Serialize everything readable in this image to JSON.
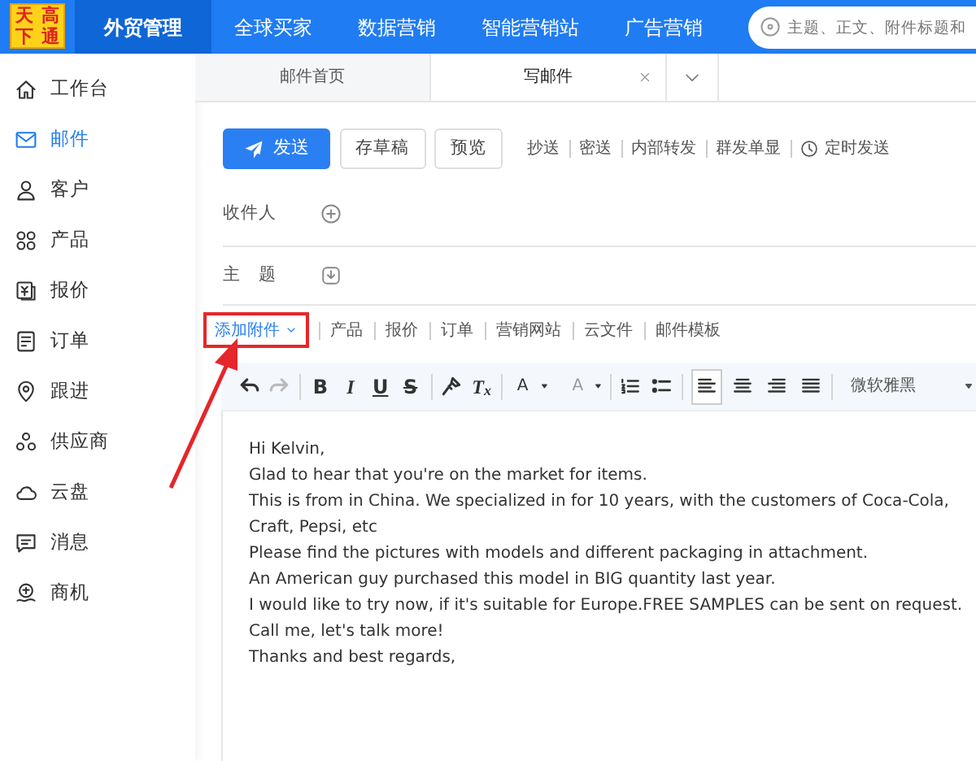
{
  "logo": {
    "chars": [
      "天",
      "高",
      "下",
      "通"
    ]
  },
  "top_nav": [
    {
      "label": "外贸管理",
      "selected": true
    },
    {
      "label": "全球买家",
      "selected": false
    },
    {
      "label": "数据营销",
      "selected": false
    },
    {
      "label": "智能营销站",
      "selected": false
    },
    {
      "label": "广告营销",
      "selected": false
    }
  ],
  "search": {
    "placeholder": "主题、正文、附件标题和"
  },
  "sidebar": {
    "items": [
      {
        "label": "工作台",
        "kind": "home",
        "selected": false
      },
      {
        "label": "邮件",
        "kind": "mail",
        "selected": true
      },
      {
        "label": "客户",
        "kind": "person",
        "selected": false
      },
      {
        "label": "产品",
        "kind": "grid",
        "selected": false
      },
      {
        "label": "报价",
        "kind": "quote",
        "selected": false
      },
      {
        "label": "订单",
        "kind": "document",
        "selected": false
      },
      {
        "label": "跟进",
        "kind": "pin",
        "selected": false
      },
      {
        "label": "供应商",
        "kind": "people",
        "selected": false
      },
      {
        "label": "云盘",
        "kind": "cloud",
        "selected": false
      },
      {
        "label": "消息",
        "kind": "chat",
        "selected": false
      },
      {
        "label": "商机",
        "kind": "handshake",
        "selected": false
      }
    ]
  },
  "tabs": [
    {
      "label": "邮件首页",
      "selected": false,
      "closable": false
    },
    {
      "label": "写邮件",
      "selected": true,
      "closable": true
    }
  ],
  "actions": {
    "send": "发送",
    "draft": "存草稿",
    "preview": "预览",
    "links": [
      {
        "label": "抄送",
        "kind": "text"
      },
      {
        "label": "密送",
        "kind": "text"
      },
      {
        "label": "内部转发",
        "kind": "text"
      },
      {
        "label": "群发单显",
        "kind": "text"
      },
      {
        "label": "定时发送",
        "kind": "clock"
      }
    ]
  },
  "recipient_label": "收件人",
  "subject_label": "主　题",
  "attachments": [
    {
      "label": "添加附件",
      "dropdown": true,
      "highlighted": true
    },
    {
      "label": "产品",
      "dropdown": false,
      "highlighted": false
    },
    {
      "label": "报价",
      "dropdown": false,
      "highlighted": false
    },
    {
      "label": "订单",
      "dropdown": false,
      "highlighted": false
    },
    {
      "label": "营销网站",
      "dropdown": false,
      "highlighted": false
    },
    {
      "label": "云文件",
      "dropdown": false,
      "highlighted": false
    },
    {
      "label": "邮件模板",
      "dropdown": false,
      "highlighted": false
    }
  ],
  "editor_toolbar": {
    "redo_enabled": false,
    "format_buttons": [
      "B",
      "I",
      "U",
      "S"
    ],
    "clear_format": "T$_{x}$",
    "font_color": "A",
    "highlight_color": "A",
    "alignments": [
      {
        "selected": true
      },
      {
        "selected": false
      },
      {
        "selected": false
      },
      {
        "selected": false
      }
    ],
    "font": "微软雅黑"
  },
  "body_lines": [
    "Hi Kelvin,",
    "Glad to hear that you're on the market for items.",
    "This is from in China. We specialized in for 10 years, with the customers of Coca-Cola, Craft, Pepsi, etc",
    "Please find the pictures with models and different packaging in attachment.",
    "An American guy purchased this model in BIG quantity last year.",
    "I would like to try now, if it's suitable for Europe.FREE SAMPLES can be sent on request.",
    "Call me, let's talk more!",
    "Thanks and best regards,"
  ]
}
